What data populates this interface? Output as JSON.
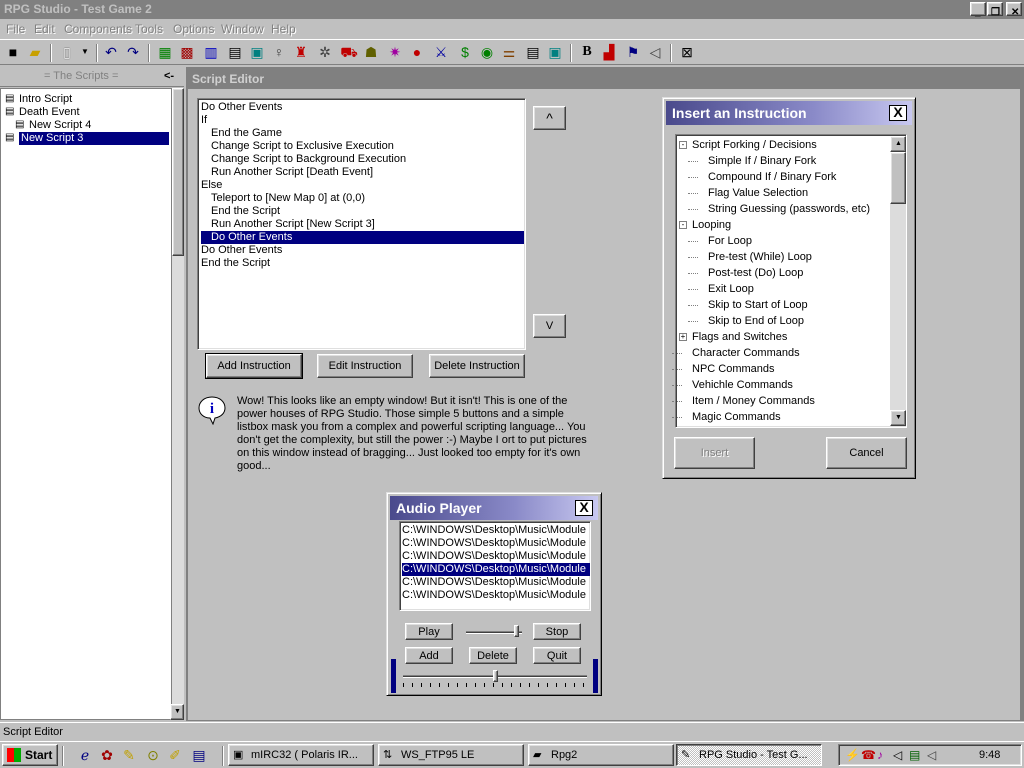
{
  "window": {
    "title": "RPG Studio - Test Game 2"
  },
  "menu": [
    "File",
    "Edit",
    "Components",
    "Tools",
    "Options",
    "Window",
    "Help"
  ],
  "scripts_panel": {
    "header": "= The Scripts =",
    "collapse_glyph": "<-",
    "items": [
      {
        "label": "Intro Script",
        "indent": 0,
        "selected": false
      },
      {
        "label": "Death Event",
        "indent": 0,
        "selected": false
      },
      {
        "label": "New Script 4",
        "indent": 1,
        "selected": false
      },
      {
        "label": "New Script 3",
        "indent": 0,
        "selected": true
      }
    ]
  },
  "editor": {
    "title": "Script Editor",
    "instructions": [
      {
        "text": "Do Other Events",
        "indent": 0,
        "selected": false
      },
      {
        "text": "If",
        "indent": 0,
        "selected": false
      },
      {
        "text": "End the Game",
        "indent": 1,
        "selected": false
      },
      {
        "text": "Change Script to Exclusive Execution",
        "indent": 1,
        "selected": false
      },
      {
        "text": "Change Script to Background Execution",
        "indent": 1,
        "selected": false
      },
      {
        "text": "Run Another Script [Death Event]",
        "indent": 1,
        "selected": false
      },
      {
        "text": "Else",
        "indent": 0,
        "selected": false
      },
      {
        "text": "Teleport to [New Map 0] at (0,0)",
        "indent": 1,
        "selected": false
      },
      {
        "text": "End the Script",
        "indent": 1,
        "selected": false
      },
      {
        "text": "Run Another Script [New Script 3]",
        "indent": 1,
        "selected": false
      },
      {
        "text": "Do Other Events",
        "indent": 1,
        "selected": true
      },
      {
        "text": "Do Other Events",
        "indent": 0,
        "selected": false
      },
      {
        "text": "End the Script",
        "indent": 0,
        "selected": false
      }
    ],
    "up_label": "^",
    "down_label": "V",
    "add_label": "Add Instruction",
    "edit_label": "Edit Instruction",
    "delete_label": "Delete Instruction",
    "info": "Wow! This looks like an empty window! But it isn't! This is one of the power houses of RPG Studio. Those simple 5 buttons and a simple listbox mask you from a complex and powerful scripting language... You don't get the complexity, but still the power :-) Maybe I ort to put pictures on this window instead of bragging... Just looked too empty for it's own good..."
  },
  "insert_dialog": {
    "title": "Insert an Instruction",
    "close_glyph": "X",
    "tree": [
      {
        "label": "Script Forking / Decisions",
        "level": 0,
        "expander": "-"
      },
      {
        "label": "Simple If / Binary Fork",
        "level": 1
      },
      {
        "label": "Compound If / Binary Fork",
        "level": 1
      },
      {
        "label": "Flag Value Selection",
        "level": 1
      },
      {
        "label": "String Guessing (passwords, etc)",
        "level": 1
      },
      {
        "label": "Looping",
        "level": 0,
        "expander": "-"
      },
      {
        "label": "For Loop",
        "level": 1
      },
      {
        "label": "Pre-test (While) Loop",
        "level": 1
      },
      {
        "label": "Post-test (Do) Loop",
        "level": 1
      },
      {
        "label": "Exit Loop",
        "level": 1
      },
      {
        "label": "Skip to Start of Loop",
        "level": 1
      },
      {
        "label": "Skip to End of Loop",
        "level": 1
      },
      {
        "label": "Flags and Switches",
        "level": 0,
        "expander": "+"
      },
      {
        "label": "Character Commands",
        "level": 0
      },
      {
        "label": "NPC Commands",
        "level": 0
      },
      {
        "label": "Vehichle Commands",
        "level": 0
      },
      {
        "label": "Item / Money Commands",
        "level": 0
      },
      {
        "label": "Magic Commands",
        "level": 0
      }
    ],
    "insert_label": "Insert",
    "cancel_label": "Cancel"
  },
  "audio_player": {
    "title": "Audio Player",
    "close_glyph": "X",
    "files": [
      {
        "path": "C:\\WINDOWS\\Desktop\\Music\\Module",
        "selected": false
      },
      {
        "path": "C:\\WINDOWS\\Desktop\\Music\\Module",
        "selected": false
      },
      {
        "path": "C:\\WINDOWS\\Desktop\\Music\\Module",
        "selected": false
      },
      {
        "path": "C:\\WINDOWS\\Desktop\\Music\\Module",
        "selected": true
      },
      {
        "path": "C:\\WINDOWS\\Desktop\\Music\\Module",
        "selected": false
      },
      {
        "path": "C:\\WINDOWS\\Desktop\\Music\\Module",
        "selected": false
      }
    ],
    "play_label": "Play",
    "stop_label": "Stop",
    "add_label": "Add",
    "delete_label": "Delete",
    "quit_label": "Quit",
    "volume_level": 0.95,
    "position_level": 0.5
  },
  "statusbar": {
    "text": "Script Editor"
  },
  "taskbar": {
    "start_label": "Start",
    "tasks": [
      {
        "label": "mIRC32 ( Polaris IR...",
        "icon": "mirc-icon",
        "active": false
      },
      {
        "label": "WS_FTP95 LE",
        "icon": "ftp-icon",
        "active": false
      },
      {
        "label": "Rpg2",
        "icon": "folder-icon",
        "active": false
      },
      {
        "label": "RPG Studio - Test G...",
        "icon": "rpg-studio-icon",
        "active": true
      }
    ],
    "clock": "9:48"
  }
}
